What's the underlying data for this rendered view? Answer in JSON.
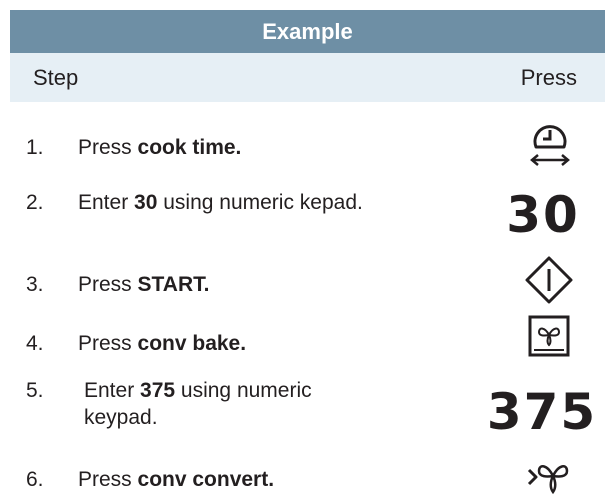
{
  "header": {
    "title": "Example"
  },
  "columns": {
    "step": "Step",
    "press": "Press"
  },
  "steps": [
    {
      "number": "1.",
      "pre": "Press ",
      "bold": "cook time.",
      "post": "",
      "press_icon": "cook-time-icon"
    },
    {
      "number": "2.",
      "pre": "Enter ",
      "bold": "30",
      "post": " using numeric kepad.",
      "press_value": "30"
    },
    {
      "number": "3.",
      "pre": "Press ",
      "bold": "START.",
      "post": "",
      "press_icon": "start-icon"
    },
    {
      "number": "4.",
      "pre": "Press ",
      "bold": "conv bake.",
      "post": "",
      "press_icon": "conv-bake-icon"
    },
    {
      "number": "5.",
      "pre": "Enter ",
      "bold": "375",
      "post": " using numeric keypad.",
      "press_value": "375"
    },
    {
      "number": "6.",
      "pre": "Press ",
      "bold": "conv convert.",
      "post": "",
      "press_icon": "conv-convert-icon"
    }
  ],
  "colors": {
    "header_bg": "#6e8fa5",
    "subheader_bg": "#e6eff5",
    "text": "#231f20"
  }
}
